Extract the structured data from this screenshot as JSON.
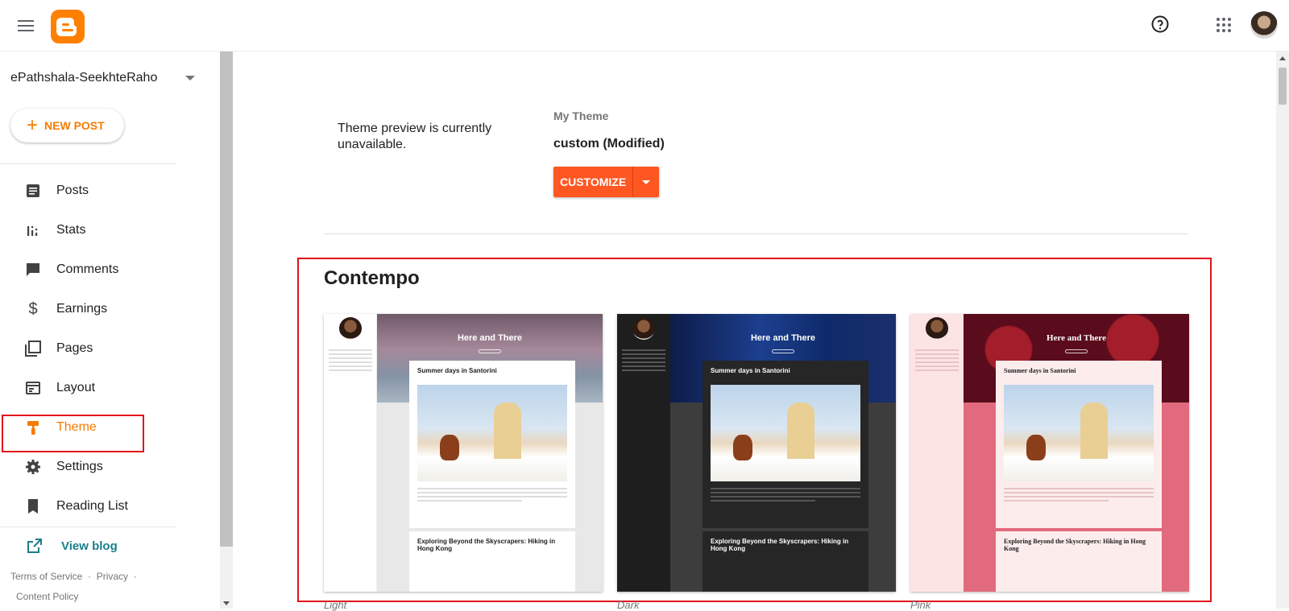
{
  "header": {
    "menu_icon": "hamburger-menu-icon",
    "logo": "blogger-logo",
    "help_icon": "help-circle-icon",
    "apps_icon": "apps-grid-icon",
    "avatar": "user-avatar"
  },
  "sidebar": {
    "blog_name": "ePathshala-SeekhteRaho",
    "new_post_label": "NEW POST",
    "items": [
      {
        "label": "Posts",
        "icon": "posts-icon"
      },
      {
        "label": "Stats",
        "icon": "stats-icon"
      },
      {
        "label": "Comments",
        "icon": "comments-icon"
      },
      {
        "label": "Earnings",
        "icon": "dollar-icon"
      },
      {
        "label": "Pages",
        "icon": "pages-icon"
      },
      {
        "label": "Layout",
        "icon": "layout-icon"
      },
      {
        "label": "Theme",
        "icon": "paint-roller-icon",
        "active": true
      },
      {
        "label": "Settings",
        "icon": "gear-icon"
      },
      {
        "label": "Reading List",
        "icon": "bookmark-icon"
      }
    ],
    "view_blog_label": "View blog",
    "footer": {
      "terms": "Terms of Service",
      "privacy": "Privacy",
      "content_policy": "Content Policy",
      "sep": "·"
    }
  },
  "main": {
    "preview_message": "Theme preview is currently unavailable.",
    "my_theme_label": "My Theme",
    "theme_name": "custom (Modified)",
    "customize_label": "CUSTOMIZE",
    "section_title": "Contempo",
    "themes": [
      {
        "caption": "Light",
        "hero_title": "Here and There",
        "post_title": "Summer days in Santorini",
        "post2_title": "Exploring Beyond the Skyscrapers: Hiking in Hong Kong"
      },
      {
        "caption": "Dark",
        "hero_title": "Here and There",
        "post_title": "Summer days in Santorini",
        "post2_title": "Exploring Beyond the Skyscrapers: Hiking in Hong Kong"
      },
      {
        "caption": "Pink",
        "hero_title": "Here and There",
        "post_title": "Summer days in Santorini",
        "post2_title": "Exploring Beyond the Skyscrapers: Hiking in Hong Kong"
      }
    ]
  },
  "colors": {
    "accent": "#f57c00",
    "customize_button": "#ff5722",
    "highlight": "#e0131c",
    "link": "#1a7f8a"
  }
}
